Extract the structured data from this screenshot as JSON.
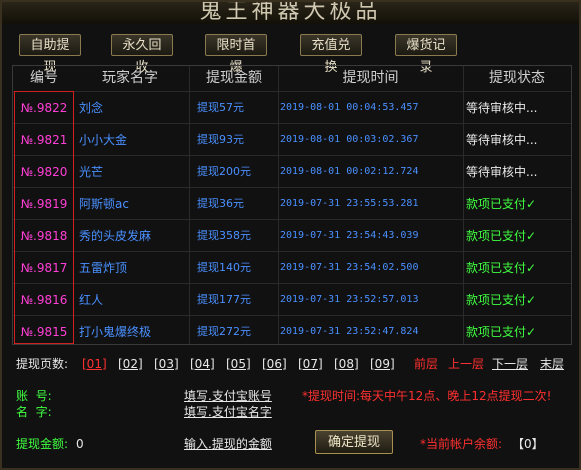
{
  "title": "鬼王神器大极品",
  "top_buttons": [
    "自助提现",
    "永久回收",
    "限时首爆",
    "充值兑换",
    "爆货记录"
  ],
  "table": {
    "headers": [
      "编号",
      "玩家名字",
      "提现金额",
      "提现时间",
      "提现状态"
    ],
    "rows": [
      {
        "num": "№.9822",
        "name": "刘念",
        "amount": "提现57元",
        "time": "2019-08-01 00:04:53.457",
        "status": "等待审核中...",
        "status_type": "wait"
      },
      {
        "num": "№.9821",
        "name": "小小大金",
        "amount": "提现93元",
        "time": "2019-08-01 00:03:02.367",
        "status": "等待审核中...",
        "status_type": "wait"
      },
      {
        "num": "№.9820",
        "name": "光芒",
        "amount": "提现200元",
        "time": "2019-08-01 00:02:12.724",
        "status": "等待审核中...",
        "status_type": "wait"
      },
      {
        "num": "№.9819",
        "name": "阿斯顿ac",
        "amount": "提现36元",
        "time": "2019-07-31 23:55:53.281",
        "status": "款项已支付✓",
        "status_type": "paid"
      },
      {
        "num": "№.9818",
        "name": "秀的头皮发麻",
        "amount": "提现358元",
        "time": "2019-07-31 23:54:43.039",
        "status": "款项已支付✓",
        "status_type": "paid"
      },
      {
        "num": "№.9817",
        "name": "五雷炸顶",
        "amount": "提现140元",
        "time": "2019-07-31 23:54:02.500",
        "status": "款项已支付✓",
        "status_type": "paid"
      },
      {
        "num": "№.9816",
        "name": "红人",
        "amount": "提现177元",
        "time": "2019-07-31 23:52:57.013",
        "status": "款项已支付✓",
        "status_type": "paid"
      },
      {
        "num": "№.9815",
        "name": "打小鬼爆终极",
        "amount": "提现272元",
        "time": "2019-07-31 23:52:47.824",
        "status": "款项已支付✓",
        "status_type": "paid"
      }
    ]
  },
  "pager": {
    "label": "提现页数:",
    "pages": [
      "[01]",
      "[02]",
      "[03]",
      "[04]",
      "[05]",
      "[06]",
      "[07]",
      "[08]",
      "[09]"
    ],
    "current_index": 0,
    "first": "前层",
    "prev": "上一层",
    "next": "下一层",
    "last": "末层"
  },
  "form": {
    "account_label": "账  号:",
    "name_label": "名  字:",
    "amount_label": "提现金额:",
    "amount_value": "0",
    "fill_account": "填写.支付宝账号",
    "fill_name": "填写.支付宝名字",
    "input_amount": "输入.提现的金额",
    "time_note": "*提现时间:每天中午12点、晚上12点提现二次!",
    "confirm": "确定提现",
    "balance_label": "*当前帐户余额:",
    "balance_value": "【0】"
  },
  "colors": {
    "number_magenta": "#ff3fd6",
    "link_blue": "#4a90ff",
    "paid_green": "#40ff40",
    "alert_red": "#ff3030"
  }
}
